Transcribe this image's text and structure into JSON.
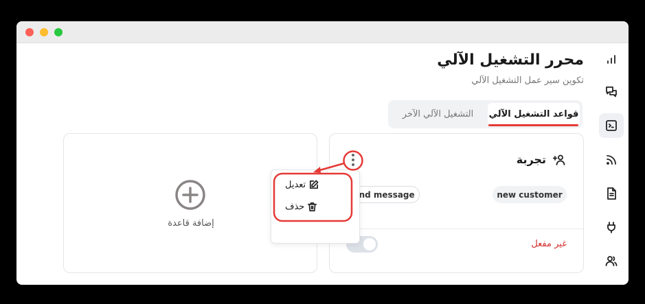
{
  "window": {
    "controls": [
      "close",
      "minimize",
      "maximize"
    ]
  },
  "sidebar": {
    "items": [
      {
        "icon": "bar-chart-icon",
        "active": false
      },
      {
        "icon": "chat-bubbles-icon",
        "active": false
      },
      {
        "icon": "terminal-icon",
        "active": true
      },
      {
        "icon": "rss-feed-icon",
        "active": false
      },
      {
        "icon": "document-icon",
        "active": false
      },
      {
        "icon": "plug-icon",
        "active": false
      },
      {
        "icon": "users-icon",
        "active": false
      }
    ]
  },
  "header": {
    "title": "محرر التشغيل الآلي",
    "subtitle": "تكوين سير عمل التشغيل الآلي"
  },
  "tabs": [
    {
      "label": "قواعد التشغيل الآلي",
      "active": true
    },
    {
      "label": "التشغيل الآلي الآخر",
      "active": false
    }
  ],
  "add_card": {
    "label": "إضافة قاعدة",
    "icon": "plus-circle-icon"
  },
  "rule_card": {
    "title": "تجربة",
    "icon": "user-plus-icon",
    "tags": [
      "new customer",
      "send message"
    ],
    "status": "غير مفعل",
    "enabled": false
  },
  "menu": {
    "items": [
      {
        "label": "تعديل",
        "icon": "edit-icon"
      },
      {
        "label": "حذف",
        "icon": "trash-icon"
      }
    ]
  },
  "colors": {
    "accent": "#e53935",
    "status_inactive": "#d32f2f",
    "annotation": "#e53935"
  }
}
